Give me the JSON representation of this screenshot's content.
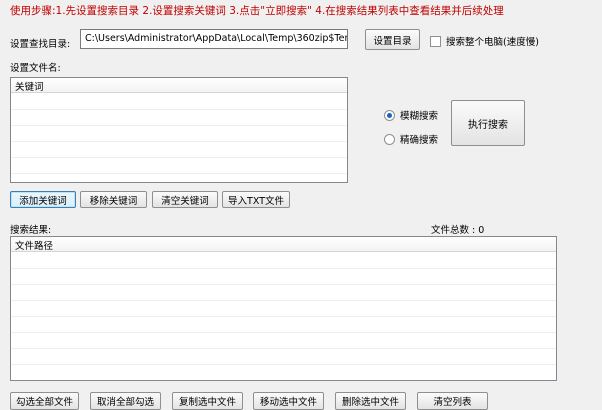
{
  "instructions": "使用步骤:1.先设置搜索目录 2.设置搜索关键词 3.点击\"立即搜索\" 4.在搜索结果列表中查看结果并后续处理",
  "search_dir": {
    "label": "设置查找目录:",
    "path": "C:\\Users\\Administrator\\AppData\\Local\\Temp\\360zip$Tem",
    "set_button": "设置目录",
    "whole_pc_checkbox": "搜索整个电脑(速度慢)",
    "whole_pc_checked": false
  },
  "filename": {
    "label": "设置文件名:",
    "column_header": "关键词"
  },
  "match_mode": {
    "fuzzy": "模糊搜索",
    "exact": "精确搜索",
    "selected": "fuzzy"
  },
  "run_button": "执行搜索",
  "keyword_buttons": {
    "add": "添加关键词",
    "remove": "移除关键词",
    "clear": "清空关键词",
    "import": "导入TXT文件"
  },
  "results": {
    "label": "搜索结果:",
    "count_label": "文件总数 : 0",
    "column_header": "文件路径"
  },
  "bottom_buttons": {
    "check_all": "勾选全部文件",
    "uncheck_all": "取消全部勾选",
    "copy": "复制选中文件",
    "move": "移动选中文件",
    "delete": "删除选中文件",
    "clear_list": "清空列表"
  }
}
